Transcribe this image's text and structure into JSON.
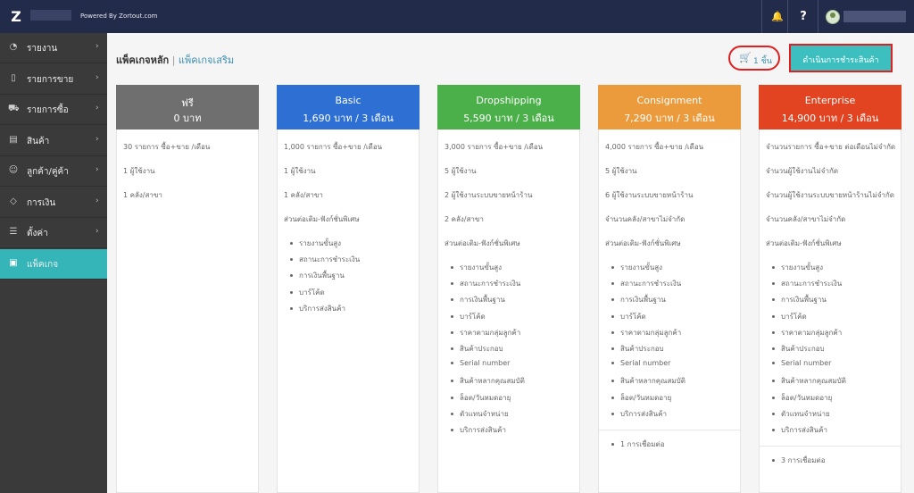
{
  "topbar": {
    "logo": "Z",
    "powered_by": "Powered By Zortout.com",
    "help_label": "?"
  },
  "sidebar": {
    "items": [
      {
        "label": "รายงาน",
        "icon": "gauge-icon",
        "glyph": "◔",
        "chevron": "›"
      },
      {
        "label": "รายการขาย",
        "icon": "document-icon",
        "glyph": "▯",
        "chevron": "›"
      },
      {
        "label": "รายการซื้อ",
        "icon": "cart-icon",
        "glyph": "⛟",
        "chevron": "›"
      },
      {
        "label": "สินค้า",
        "icon": "box-icon",
        "glyph": "▤",
        "chevron": "›"
      },
      {
        "label": "ลูกค้า/คู่ค้า",
        "icon": "users-icon",
        "glyph": "☺",
        "chevron": "›"
      },
      {
        "label": "การเงิน",
        "icon": "tag-icon",
        "glyph": "◇",
        "chevron": "›"
      },
      {
        "label": "ตั้งค่า",
        "icon": "sliders-icon",
        "glyph": "☰",
        "chevron": "›"
      },
      {
        "label": "แพ็คเกจ",
        "icon": "package-icon",
        "glyph": "▣",
        "chevron": ""
      }
    ]
  },
  "breadcrumb": {
    "main": "แพ็คเกจหลัก",
    "separator": " | ",
    "addon": "แพ็คเกจเสริม"
  },
  "cart": {
    "count_label": "1 ชิ้น"
  },
  "checkout_button": "ดำเนินการชำระสินค้า",
  "plans": [
    {
      "name": "ฟรี",
      "price": "0 บาท",
      "color": "#6f6f6f",
      "rows": [
        "30 รายการ ซื้อ+ขาย /เดือน",
        "1 ผู้ใช้งาน",
        "1 คลัง/สาขา"
      ],
      "features": [],
      "extra": ""
    },
    {
      "name": "Basic",
      "price": "1,690 บาท / 3 เดือน",
      "color": "#2d6fd3",
      "rows": [
        "1,000 รายการ ซื้อ+ขาย /เดือน",
        "1 ผู้ใช้งาน",
        "1 คลัง/สาขา",
        "ส่วนต่อเติม-ฟังก์ชั่นพิเศษ"
      ],
      "features": [
        "รายงานขั้นสูง",
        "สถานะการชำระเงิน",
        "การเงินพื้นฐาน",
        "บาร์โค้ด",
        "บริการส่งสินค้า"
      ],
      "extra": ""
    },
    {
      "name": "Dropshipping",
      "price": "5,590 บาท / 3 เดือน",
      "color": "#4bb04a",
      "rows": [
        "3,000 รายการ ซื้อ+ขาย /เดือน",
        "5 ผู้ใช้งาน",
        "2 ผู้ใช้งานระบบขายหน้าร้าน",
        "2 คลัง/สาขา",
        "ส่วนต่อเติม-ฟังก์ชั่นพิเศษ"
      ],
      "features": [
        "รายงานขั้นสูง",
        "สถานะการชำระเงิน",
        "การเงินพื้นฐาน",
        "บาร์โค้ด",
        "ราคาตามกลุ่มลูกค้า",
        "สินค้าประกอบ",
        "Serial number",
        "สินค้าหลากคุณสมบัติ",
        "ล็อต/วันหมดอายุ",
        "ตัวแทนจำหน่าย",
        "บริการส่งสินค้า"
      ],
      "extra": ""
    },
    {
      "name": "Consignment",
      "price": "7,290 บาท / 3 เดือน",
      "color": "#ec9b3c",
      "rows": [
        "4,000 รายการ ซื้อ+ขาย /เดือน",
        "5 ผู้ใช้งาน",
        "6 ผู้ใช้งานระบบขายหน้าร้าน",
        "จำนวนคลัง/สาขาไม่จำกัด",
        "ส่วนต่อเติม-ฟังก์ชั่นพิเศษ"
      ],
      "features": [
        "รายงานขั้นสูง",
        "สถานะการชำระเงิน",
        "การเงินพื้นฐาน",
        "บาร์โค้ด",
        "ราคาตามกลุ่มลูกค้า",
        "สินค้าประกอบ",
        "Serial number",
        "สินค้าหลากคุณสมบัติ",
        "ล็อต/วันหมดอายุ",
        "บริการส่งสินค้า"
      ],
      "extra": "1 การเชื่อมต่อ"
    },
    {
      "name": "Enterprise",
      "price": "14,900 บาท / 3 เดือน",
      "color": "#e24321",
      "rows": [
        "จำนวนรายการ ซื้อ+ขาย ต่อเดือนไม่จำกัด",
        "จำนวนผู้ใช้งานไม่จำกัด",
        "จำนวนผู้ใช้งานระบบขายหน้าร้านไม่จำกัด",
        "จำนวนคลัง/สาขาไม่จำกัด",
        "ส่วนต่อเติม-ฟังก์ชั่นพิเศษ"
      ],
      "features": [
        "รายงานขั้นสูง",
        "สถานะการชำระเงิน",
        "การเงินพื้นฐาน",
        "บาร์โค้ด",
        "ราคาตามกลุ่มลูกค้า",
        "สินค้าประกอบ",
        "Serial number",
        "สินค้าหลากคุณสมบัติ",
        "ล็อต/วันหมดอายุ",
        "ตัวแทนจำหน่าย",
        "บริการส่งสินค้า"
      ],
      "extra": "3 การเชื่อมต่อ"
    }
  ]
}
